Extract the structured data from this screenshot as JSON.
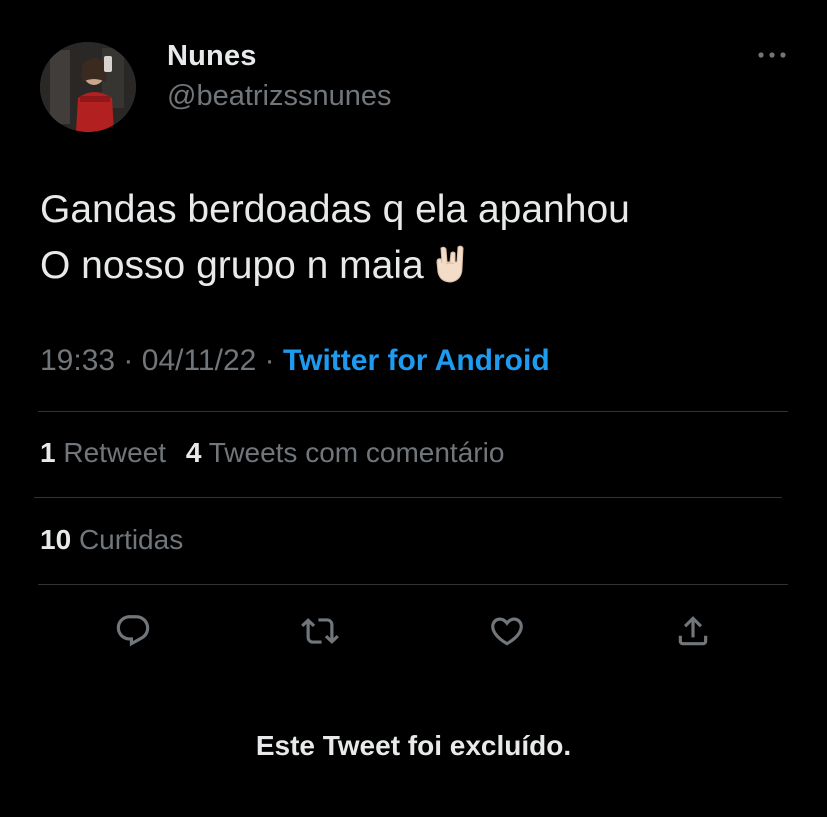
{
  "author": {
    "display_name": "Nunes",
    "handle": "@beatrizssnunes",
    "avatar_icon": "user-avatar-photo"
  },
  "tweet": {
    "line1": "Gandas berdoadas q ela apanhou",
    "line2": "O nosso grupo n maia",
    "emoji_icon": "sign-of-the-horns-emoji"
  },
  "meta": {
    "time": "19:33",
    "separator": "·",
    "date": "04/11/22",
    "source": "Twitter for Android"
  },
  "stats": {
    "retweets_count": "1",
    "retweets_label": "Retweet",
    "quotes_count": "4",
    "quotes_label": "Tweets com comentário",
    "likes_count": "10",
    "likes_label": "Curtidas"
  },
  "actions": [
    {
      "icon": "reply-icon"
    },
    {
      "icon": "retweet-icon"
    },
    {
      "icon": "like-icon"
    },
    {
      "icon": "share-icon"
    }
  ],
  "notice": "Este Tweet foi excluído.",
  "colors": {
    "background": "#000000",
    "primary_text": "#e7e9ea",
    "secondary_text": "#71767b",
    "link": "#1d9bf0",
    "divider": "#2f3336"
  }
}
